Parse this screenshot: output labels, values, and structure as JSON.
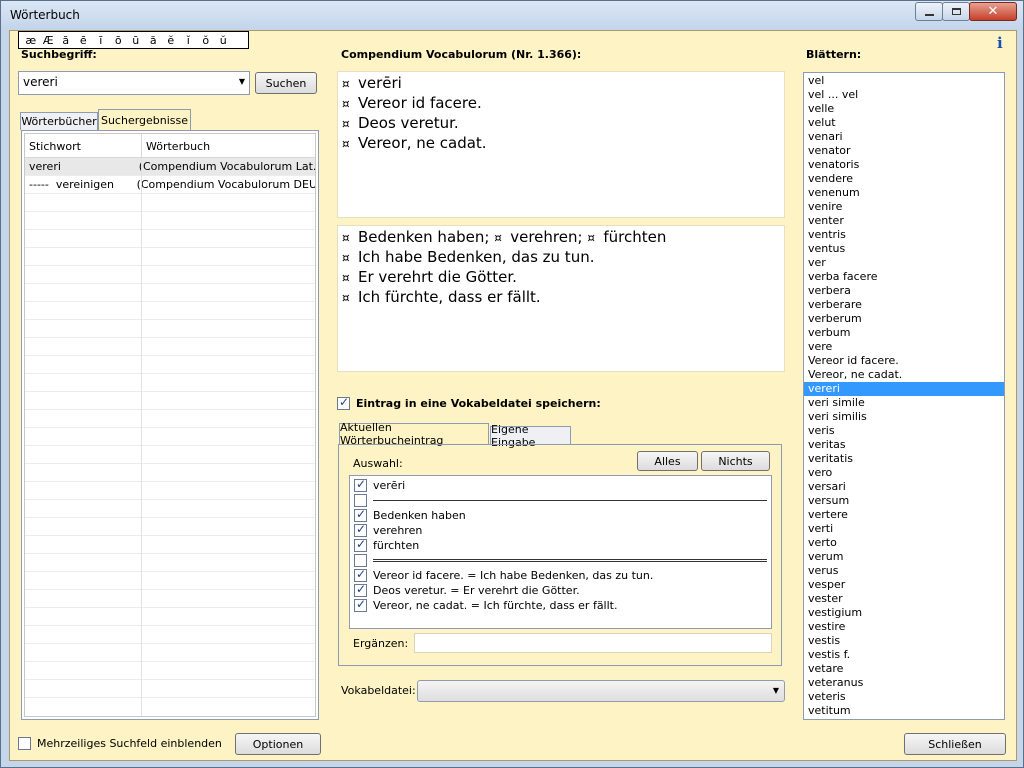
{
  "window": {
    "title": "Wörterbuch"
  },
  "charbar": [
    "æ",
    "Æ",
    "ā",
    "ē",
    "ī",
    "ō",
    "ū",
    "ă",
    "ĕ",
    "ĭ",
    "ŏ",
    "ŭ"
  ],
  "search": {
    "label": "Suchbegriff:",
    "value": "vereri",
    "button": "Suchen"
  },
  "tabs_left": [
    {
      "label": "Wörterbücher"
    },
    {
      "label": "Suchergebnisse"
    }
  ],
  "results": {
    "col1": "Stichwort",
    "col2": "Wörterbuch",
    "rows": [
      {
        "word": "vereri",
        "dict": "(Compendium Vocabulorum Lat..."
      },
      {
        "word": "-----  vereinigen",
        "dict": "(Compendium Vocabulorum DEU..."
      }
    ]
  },
  "multiline": {
    "label": "Mehrzeiliges Suchfeld einblenden"
  },
  "options_button": "Optionen",
  "entry": {
    "header": "Compendium Vocabulorum (Nr. 1.366):",
    "latin": [
      "verēri",
      "Vereor id facere.",
      "Deos veretur.",
      "Vereor, ne cadat."
    ],
    "german_first": [
      "Bedenken haben;",
      "verehren;",
      "fürchten"
    ],
    "german": [
      "Ich habe Bedenken, das zu tun.",
      "Er verehrt die Götter.",
      "Ich fürchte, dass er fällt."
    ],
    "symbol": "¤"
  },
  "save": {
    "label": "Eintrag in eine Vokabeldatei speichern:"
  },
  "tabs_center": [
    {
      "label": "Aktuellen Wörterbucheintrag"
    },
    {
      "label": "Eigene Eingabe"
    }
  ],
  "auswahl": {
    "label": "Auswahl:",
    "all": "Alles",
    "none": "Nichts",
    "items": [
      {
        "text": "verēri",
        "checked": true,
        "type": "text"
      },
      {
        "text": "",
        "checked": false,
        "type": "sep"
      },
      {
        "text": "Bedenken haben",
        "checked": true,
        "type": "text"
      },
      {
        "text": "verehren",
        "checked": true,
        "type": "text"
      },
      {
        "text": "fürchten",
        "checked": true,
        "type": "text"
      },
      {
        "text": "",
        "checked": false,
        "type": "sep2"
      },
      {
        "text": "Vereor id facere. = Ich habe Bedenken, das zu tun.",
        "checked": true,
        "type": "text"
      },
      {
        "text": "Deos veretur. = Er verehrt die Götter.",
        "checked": true,
        "type": "text"
      },
      {
        "text": "Vereor, ne cadat. = Ich fürchte, dass er fällt.",
        "checked": true,
        "type": "text"
      }
    ]
  },
  "ergaenzen": {
    "label": "Ergänzen:",
    "value": ""
  },
  "vokabeldatei": {
    "label": "Vokabeldatei:",
    "value": ""
  },
  "browse": {
    "label": "Blättern:",
    "items": [
      "vel",
      "vel ... vel",
      "velle",
      "velut",
      "venari",
      "venator",
      "venatoris",
      "vendere",
      "venenum",
      "venire",
      "venter",
      "ventris",
      "ventus",
      "ver",
      "verba facere",
      "verbera",
      "verberare",
      "verberum",
      "verbum",
      "vere",
      "Vereor id facere.",
      "Vereor, ne cadat.",
      "vereri",
      "veri simile",
      "veri similis",
      "veris",
      "veritas",
      "veritatis",
      "vero",
      "versari",
      "versum",
      "vertere",
      "verti",
      "verto",
      "verum",
      "verus",
      "vesper",
      "vester",
      "vestigium",
      "vestire",
      "vestis",
      "vestis f.",
      "vetare",
      "veteranus",
      "veteris",
      "vetitum"
    ],
    "selected": "vereri"
  },
  "close_button": "Schließen"
}
